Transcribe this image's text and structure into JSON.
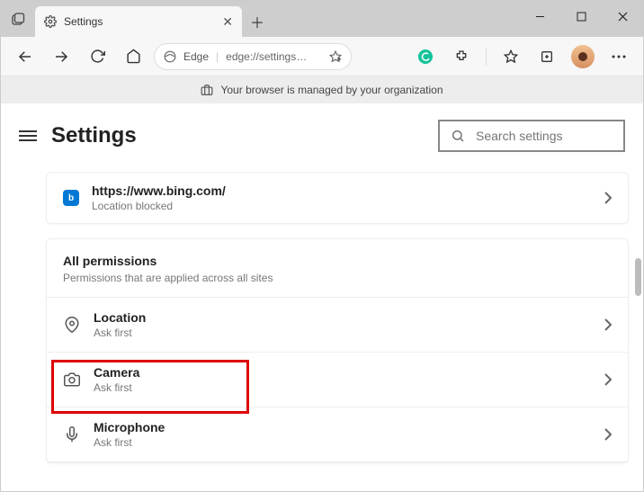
{
  "tab": {
    "title": "Settings"
  },
  "toolbar": {
    "browser_label": "Edge",
    "url": "edge://settings…"
  },
  "managed_banner": "Your browser is managed by your organization",
  "settings": {
    "title": "Settings",
    "search_placeholder": "Search settings"
  },
  "recent_site": {
    "url": "https://www.bing.com/",
    "status": "Location blocked"
  },
  "all_permissions": {
    "title": "All permissions",
    "subtitle": "Permissions that are applied across all sites",
    "items": [
      {
        "title": "Location",
        "sub": "Ask first"
      },
      {
        "title": "Camera",
        "sub": "Ask first"
      },
      {
        "title": "Microphone",
        "sub": "Ask first"
      }
    ]
  }
}
